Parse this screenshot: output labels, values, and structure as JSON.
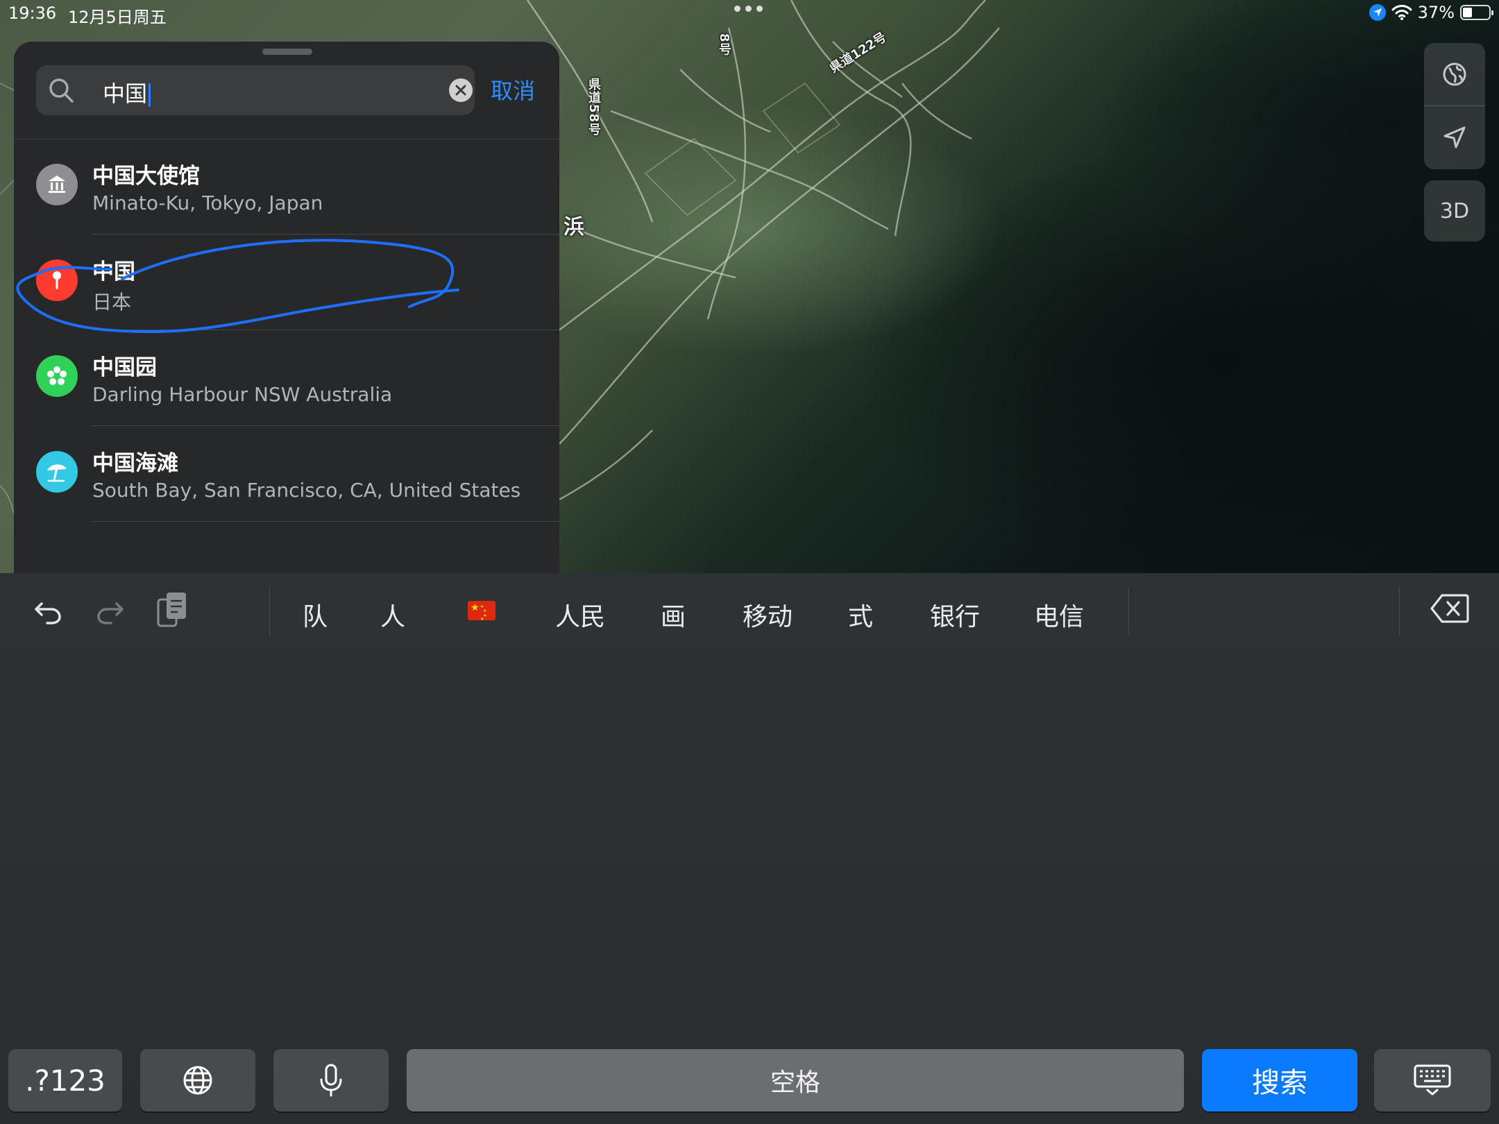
{
  "status_bar": {
    "time": "19:36",
    "date": "12月5日周五",
    "battery": "37%"
  },
  "map": {
    "labels": {
      "road_8": "8号",
      "road_122": "県道122号",
      "road_58": "県道58号",
      "place_hama": "浜"
    },
    "controls": {
      "globe": "globe-icon",
      "location": "location-arrow-icon",
      "view_3d": "3D"
    }
  },
  "search": {
    "query": "中国",
    "cancel_label": "取消"
  },
  "results": [
    {
      "title": "中国大使馆",
      "subtitle": "Minato-Ku, Tokyo, Japan",
      "icon": "embassy-icon",
      "color": "#8e8e93"
    },
    {
      "title": "中国",
      "subtitle": "日本",
      "icon": "location-pin-icon",
      "color": "#ff3b30"
    },
    {
      "title": "中国园",
      "subtitle": "Darling Harbour NSW Australia",
      "icon": "flower-icon",
      "color": "#30d158"
    },
    {
      "title": "中国海滩",
      "subtitle": "South Bay, San Francisco, CA, United States",
      "icon": "beach-umbrella-icon",
      "color": "#32c8e6"
    }
  ],
  "keyboard": {
    "candidates": [
      "队",
      "人",
      "人民",
      "画",
      "移动",
      "式",
      "银行",
      "电信"
    ],
    "flag_candidate": "china-flag-emoji",
    "keys": {
      "numbers": ".?123",
      "space": "空格",
      "search": "搜索"
    }
  },
  "colors": {
    "accent": "#0a7aff",
    "panel_bg": "#272829",
    "annotation": "#1f6fff"
  }
}
